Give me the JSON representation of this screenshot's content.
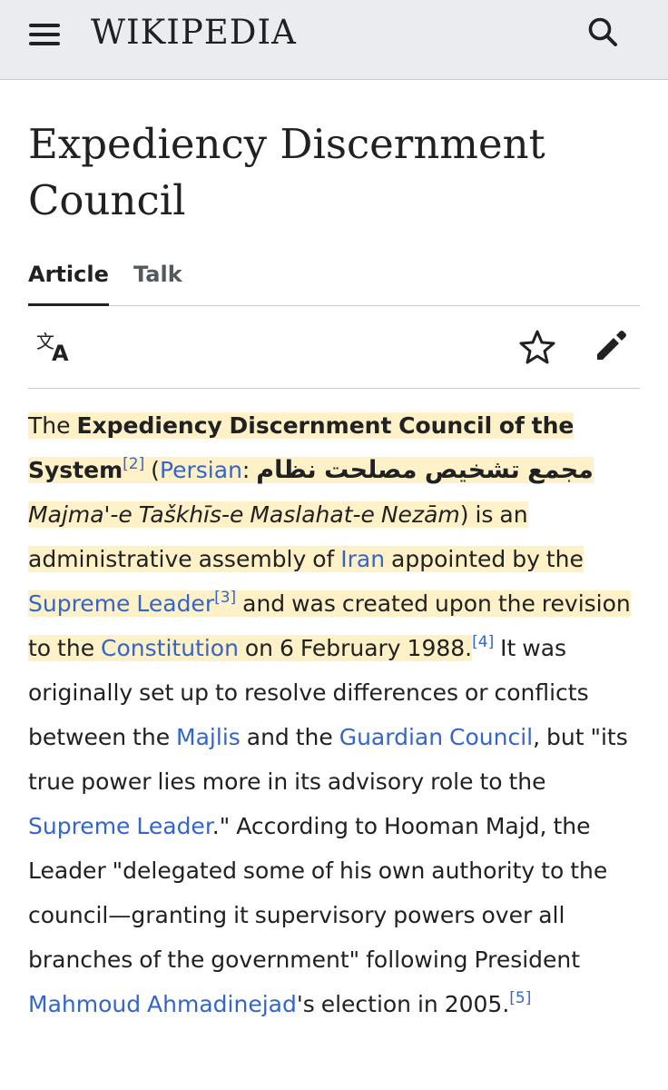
{
  "header": {
    "wordmark": "WIKIPEDIA",
    "menu_icon": "hamburger-menu-icon",
    "search_icon": "search-icon"
  },
  "page": {
    "title": "Expediency Discernment Council"
  },
  "tabs": [
    {
      "label": "Article",
      "selected": true
    },
    {
      "label": "Talk",
      "selected": false
    }
  ],
  "actions": {
    "language_icon": "translate-icon",
    "watch_icon": "star-icon",
    "edit_icon": "pencil-icon"
  },
  "paragraph": {
    "t01": "The ",
    "bold_name": "Expediency Discernment Council of the System",
    "ref2": "[2]",
    "t02": " (",
    "link_persian": "Persian",
    "t03": ": ",
    "persian_text": "مجمع تشخیص مصلحت نظام",
    "t04": " ",
    "transliteration": "Majma'-e Taškhīs-e Maslahat-e Nezām",
    "t05": ") is an administrative assembly of ",
    "link_iran": "Iran",
    "t06": " appointed by the ",
    "link_supreme_leader": "Supreme Leader",
    "ref3": "[3]",
    "t07": " and was created upon the revision to the ",
    "link_constitution": "Constitution",
    "t08": " on 6 February 1988.",
    "ref4": "[4]",
    "t09": " It was originally set up to resolve differences or conflicts between the ",
    "link_majlis": "Majlis",
    "t10": " and the ",
    "link_guardian_council": "Guardian Council",
    "t11": ", but \"its true power lies more in its advisory role to the ",
    "link_supreme_leader_2": "Supreme Leader",
    "t12": ".\" According to Hooman Majd, the Leader \"delegated some of his own authority to the council—granting it supervisory powers over all branches of the government\" following President ",
    "link_ahmadinejad": "Mahmoud Ahmadinejad",
    "t13": "'s election in 2005.",
    "ref5": "[5]"
  },
  "colors": {
    "link": "#3366cc",
    "highlight": "#fef0c7",
    "header_bg": "#eaecf0",
    "text": "#202122"
  }
}
